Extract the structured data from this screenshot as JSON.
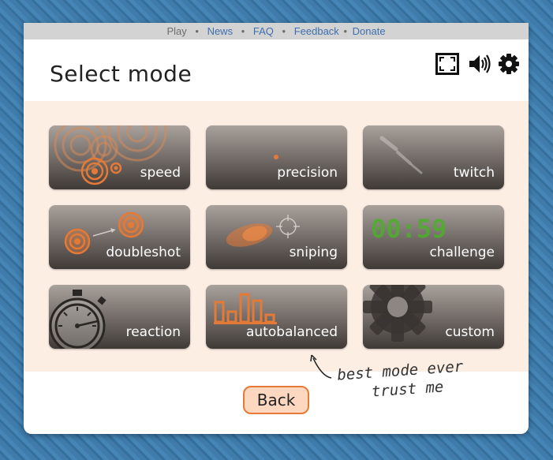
{
  "nav": {
    "current": "Play",
    "links": [
      "News",
      "FAQ",
      "Feedback",
      "Donate"
    ],
    "separator": "•"
  },
  "page_title": "Select mode",
  "toolbar_icons": [
    "fullscreen-icon",
    "speaker-icon",
    "gear-icon"
  ],
  "modes": [
    {
      "id": "speed",
      "label": "speed"
    },
    {
      "id": "precision",
      "label": "precision"
    },
    {
      "id": "twitch",
      "label": "twitch"
    },
    {
      "id": "doubleshot",
      "label": "doubleshot"
    },
    {
      "id": "sniping",
      "label": "sniping"
    },
    {
      "id": "challenge",
      "label": "challenge",
      "timer": "00:59"
    },
    {
      "id": "reaction",
      "label": "reaction"
    },
    {
      "id": "autobalanced",
      "label": "autobalanced"
    },
    {
      "id": "custom",
      "label": "custom"
    }
  ],
  "back_label": "Back",
  "annotation": {
    "line1": "best mode ever",
    "line2": "trust me"
  },
  "colors": {
    "accent_orange": "#e57a36",
    "panel_bg": "#fdeee4",
    "timer_green": "#4caf2a",
    "link_blue": "#3f6fae"
  }
}
